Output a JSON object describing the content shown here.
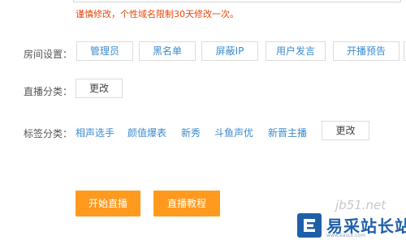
{
  "notice": "谨慎修改，个性域名限制30天修改一次。",
  "room_settings": {
    "label": "房间设置：",
    "buttons": [
      "管理员",
      "黑名单",
      "屏蔽IP",
      "用户发言",
      "开播预告"
    ]
  },
  "live_category": {
    "label": "直播分类：",
    "change_label": "更改"
  },
  "tag_category": {
    "label": "标签分类：",
    "tags": [
      "相声选手",
      "颜值爆表",
      "新秀",
      "斗鱼声优",
      "新晋主播"
    ],
    "change_label": "更改"
  },
  "actions": {
    "start_live": "开始直播",
    "tutorial": "直播教程"
  },
  "watermark": {
    "site_text": "jb51.net",
    "brand": "易采站长站",
    "sub": "www.easck.com"
  },
  "colors": {
    "notice": "#e8450a",
    "link": "#3c8ad0",
    "primary": "#ff9a1f",
    "brand": "#1f5fa8"
  }
}
